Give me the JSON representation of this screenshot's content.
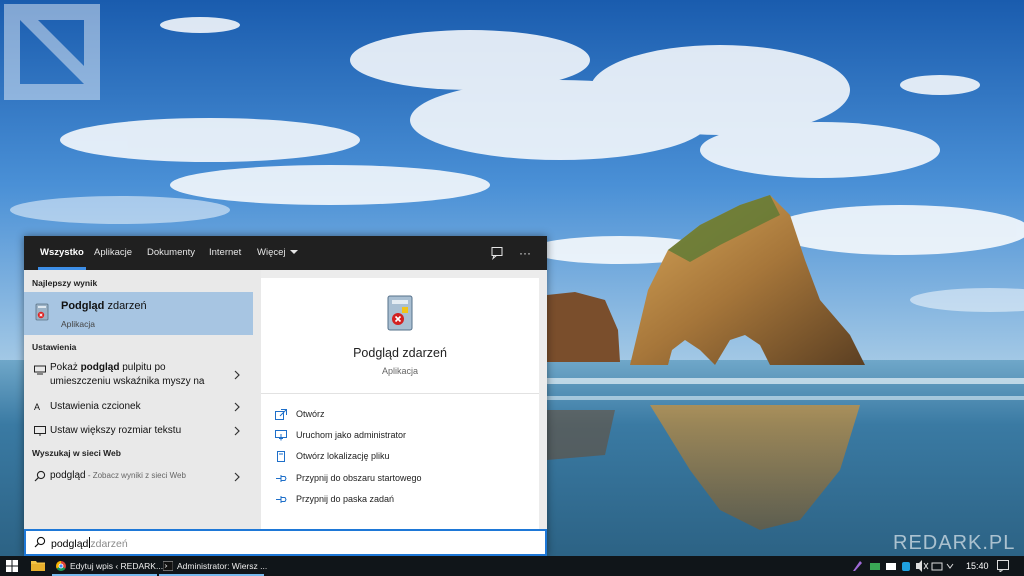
{
  "search_panel": {
    "tabs": [
      {
        "label": "Wszystko",
        "active": true
      },
      {
        "label": "Aplikacje",
        "active": false
      },
      {
        "label": "Dokumenty",
        "active": false
      },
      {
        "label": "Internet",
        "active": false
      },
      {
        "label": "Więcej",
        "active": false
      }
    ],
    "best_match": {
      "heading": "Najlepszy wynik",
      "title_bold": "Podgląd",
      "title_rest": " zdarzeń",
      "subtitle": "Aplikacja"
    },
    "settings": {
      "heading": "Ustawienia",
      "items": [
        {
          "pre": "Pokaż ",
          "bold": "podgląd",
          "post": " pulpitu po",
          "line2": "umieszczeniu wskaźnika myszy na"
        },
        {
          "label": "Ustawienia czcionek"
        },
        {
          "label": "Ustaw większy rozmiar tekstu"
        }
      ]
    },
    "web": {
      "heading": "Wyszukaj w sieci Web",
      "query": "podgląd",
      "hint": " - Zobacz wyniki z sieci Web"
    },
    "preview": {
      "title": "Podgląd zdarzeń",
      "subtitle": "Aplikacja",
      "actions": [
        {
          "label": "Otwórz",
          "icon": "open-icon"
        },
        {
          "label": "Uruchom jako administrator",
          "icon": "run-as-admin-icon"
        },
        {
          "label": "Otwórz lokalizację pliku",
          "icon": "file-location-icon"
        },
        {
          "label": "Przypnij do obszaru startowego",
          "icon": "pin-icon"
        },
        {
          "label": "Przypnij do paska zadań",
          "icon": "pin-icon"
        }
      ]
    },
    "search_box": {
      "typed": "podgląd",
      "suggestion": "zdarzeń"
    }
  },
  "taskbar": {
    "apps": [
      {
        "label": "Edytuj wpis ‹ REDARK...",
        "icon": "chrome-icon"
      },
      {
        "label": "Administrator: Wiersz ...",
        "icon": "cmd-icon"
      }
    ],
    "clock": "15:40"
  },
  "watermark": "REDARK.PL",
  "colors": {
    "accent": "#3d8ee6",
    "selection": "#a7c5e2",
    "topbar": "#202020",
    "taskbar": "#101519"
  }
}
